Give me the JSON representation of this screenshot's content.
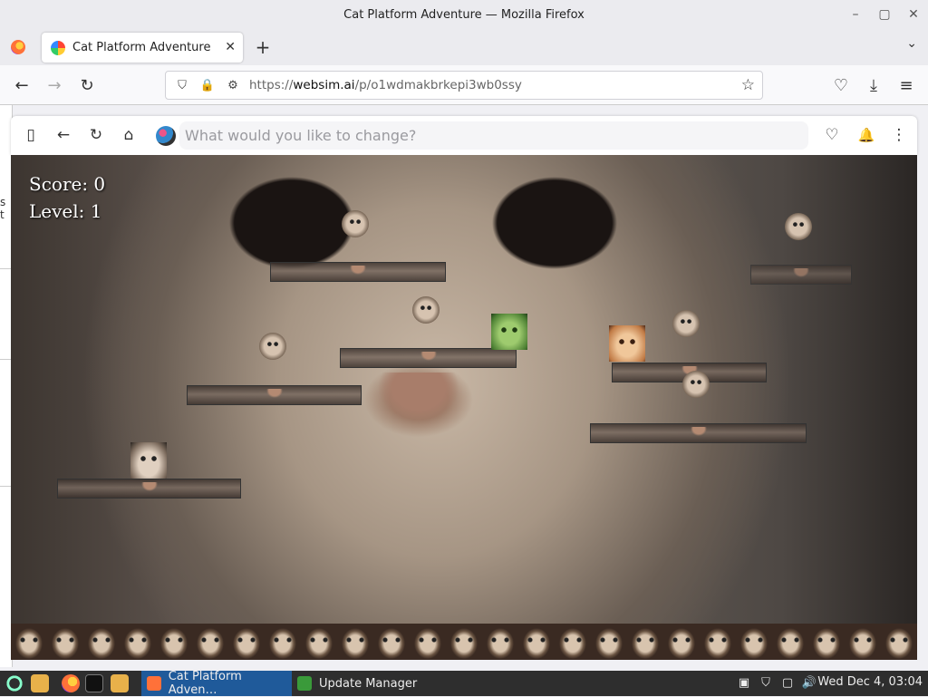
{
  "window": {
    "title": "Cat Platform Adventure — Mozilla Firefox",
    "minimize_glyph": "–",
    "maximize_glyph": "▢",
    "close_glyph": "✕"
  },
  "tab": {
    "label": "Cat Platform Adventure",
    "close_glyph": "✕",
    "new_tab_glyph": "+",
    "list_glyph": "⌄"
  },
  "nav": {
    "back_glyph": "←",
    "forward_glyph": "→",
    "reload_glyph": "↻",
    "url_prefix": "https://",
    "url_host": "websim.ai",
    "url_path": "/p/o1wdmakbrkepi3wb0ssy",
    "shield_glyph": "⛉",
    "lock_glyph": "🔒",
    "perm_glyph": "⚙",
    "star_glyph": "☆",
    "pocket_glyph": "♡",
    "download_glyph": "⤓",
    "menu_glyph": "≡"
  },
  "websim": {
    "sidebar_glyph": "▯",
    "back_glyph": "←",
    "reload_glyph": "↻",
    "home_glyph": "⌂",
    "prompt_placeholder": "What would you like to change?",
    "like_glyph": "♡",
    "bell_glyph": "🔔",
    "more_glyph": "⋮"
  },
  "side_peek": {
    "text": "s t"
  },
  "game": {
    "score_label": "Score: 0",
    "level_label": "Level: 1"
  },
  "taskbar": {
    "apps": [
      {
        "label": "Cat Platform Adven…",
        "active": true
      },
      {
        "label": "Update Manager",
        "active": false
      }
    ],
    "clock": "Wed Dec  4, 03:04"
  },
  "colors": {
    "accent": "#1f5a9a",
    "hud_text": "#ffffff"
  }
}
